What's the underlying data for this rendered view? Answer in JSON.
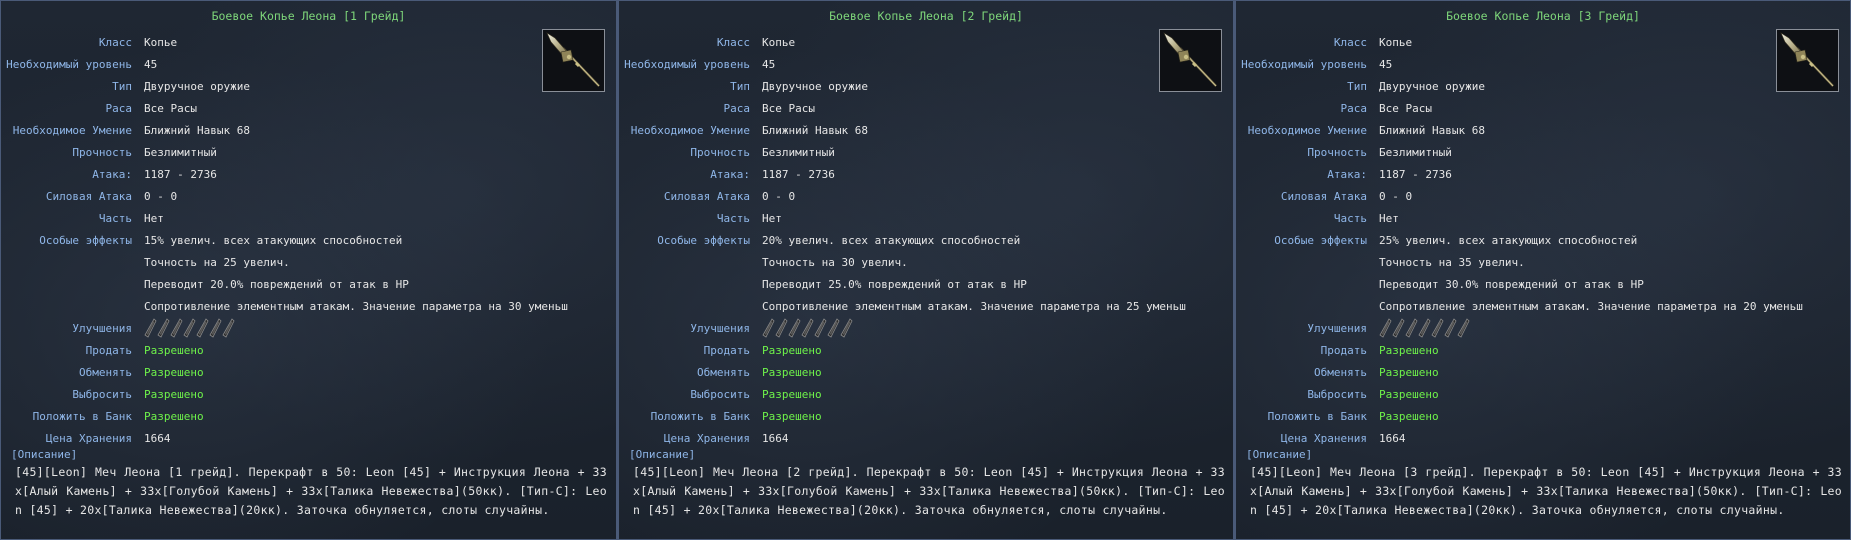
{
  "labels": {
    "class": "Класс",
    "level": "Необходимый уровень",
    "type": "Тип",
    "race": "Раса",
    "skill": "Необходимое Умение",
    "durability": "Прочность",
    "attack": "Атака:",
    "power_attack": "Силовая Атака",
    "part": "Часть",
    "effects": "Особые эффекты",
    "upgrades": "Улучшения",
    "sell": "Продать",
    "trade": "Обменять",
    "drop": "Выбросить",
    "bank": "Положить в Банк",
    "storage_price": "Цена Хранения",
    "description": "[Описание]"
  },
  "colors": {
    "title": "#7ed67a",
    "label": "#8fb6e8",
    "value": "#e6e6e6",
    "allowed": "#6ef24a",
    "border": "#4a5a78"
  },
  "icons": {
    "item": "spear-icon",
    "upgrade_slot": "enchant-slot-icon"
  },
  "upgrade_slots": 7,
  "panels": [
    {
      "title": "Боевое Копье Леона [1 Грейд]",
      "class": "Копье",
      "level": "45",
      "type": "Двуручное оружие",
      "race": "Все Расы",
      "skill": "Ближний Навык 68",
      "durability": "Безлимитный",
      "attack": "1187 - 2736",
      "power_attack": "0 - 0",
      "part": "Нет",
      "effects": [
        "15% увелич. всех атакующих способностей",
        "Точность на 25 увелич.",
        "Переводит 20.0% повреждений от атак в HP",
        "Сопротивление элементным атакам. Значение параметра на 30 уменьш"
      ],
      "sell": "Разрешено",
      "trade": "Разрешено",
      "drop": "Разрешено",
      "bank": "Разрешено",
      "storage_price": "1664",
      "description": "[45][Leon] Меч Леона [1 грейд]. Перекрафт в 50: Leon [45] + Инструкция Леона + 33x[Алый Камень] + 33x[Голубой Камень] + 33x[Талика Невежества](50кк). [Тип-C]: Leon [45] + 20x[Талика Невежества](20кк). Заточка обнуляется, слоты случайны."
    },
    {
      "title": "Боевое Копье Леона [2 Грейд]",
      "class": "Копье",
      "level": "45",
      "type": "Двуручное оружие",
      "race": "Все Расы",
      "skill": "Ближний Навык 68",
      "durability": "Безлимитный",
      "attack": "1187 - 2736",
      "power_attack": "0 - 0",
      "part": "Нет",
      "effects": [
        "20% увелич. всех атакующих способностей",
        "Точность на 30 увелич.",
        "Переводит 25.0% повреждений от атак в HP",
        "Сопротивление элементным атакам. Значение параметра на 25 уменьш"
      ],
      "sell": "Разрешено",
      "trade": "Разрешено",
      "drop": "Разрешено",
      "bank": "Разрешено",
      "storage_price": "1664",
      "description": "[45][Leon] Меч Леона [2 грейд]. Перекрафт в 50: Leon [45] + Инструкция Леона + 33x[Алый Камень] + 33x[Голубой Камень] + 33x[Талика Невежества](50кк). [Тип-C]: Leon [45] + 20x[Талика Невежества](20кк). Заточка обнуляется, слоты случайны."
    },
    {
      "title": "Боевое Копье Леона [3 Грейд]",
      "class": "Копье",
      "level": "45",
      "type": "Двуручное оружие",
      "race": "Все Расы",
      "skill": "Ближний Навык 68",
      "durability": "Безлимитный",
      "attack": "1187 - 2736",
      "power_attack": "0 - 0",
      "part": "Нет",
      "effects": [
        "25% увелич. всех атакующих способностей",
        "Точность на 35 увелич.",
        "Переводит 30.0% повреждений от атак в HP",
        "Сопротивление элементным атакам. Значение параметра на 20 уменьш"
      ],
      "sell": "Разрешено",
      "trade": "Разрешено",
      "drop": "Разрешено",
      "bank": "Разрешено",
      "storage_price": "1664",
      "description": "[45][Leon] Меч Леона [3 грейд]. Перекрафт в 50: Leon [45] + Инструкция Леона + 33x[Алый Камень] + 33x[Голубой Камень] + 33x[Талика Невежества](50кк). [Тип-C]: Leon [45] + 20x[Талика Невежества](20кк). Заточка обнуляется, слоты случайны."
    }
  ]
}
